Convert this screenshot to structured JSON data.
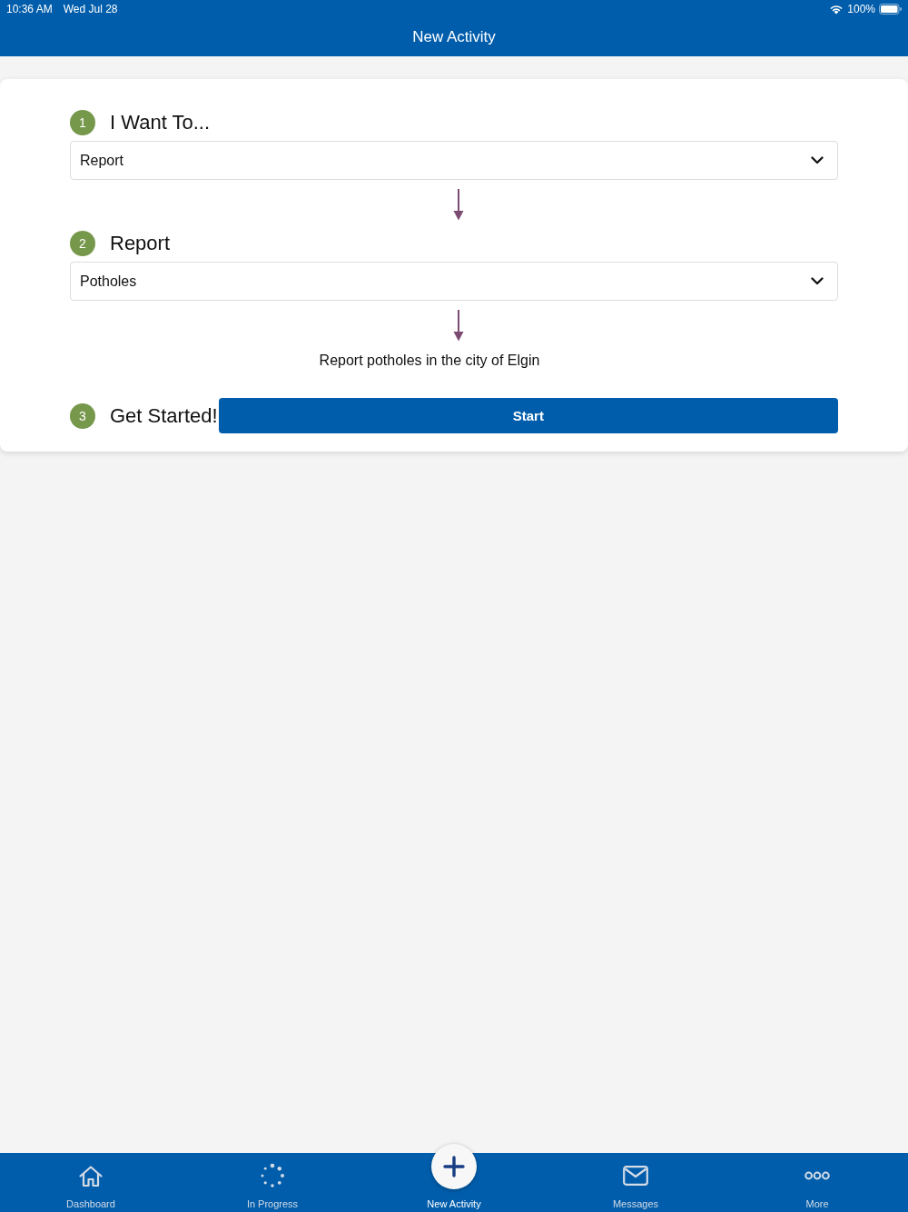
{
  "status_bar": {
    "time": "10:36 AM",
    "date": "Wed Jul 28",
    "battery": "100%"
  },
  "nav_bar": {
    "title": "New Activity"
  },
  "steps": [
    {
      "kind": "select",
      "number": "1",
      "title": "I Want To...",
      "value": "Report"
    },
    {
      "kind": "select",
      "number": "2",
      "title": "Report",
      "value": "Potholes",
      "description": "Report potholes in the city of Elgin"
    },
    {
      "kind": "action",
      "number": "3",
      "title": "Get Started!",
      "button": "Start"
    }
  ],
  "tab_bar": [
    {
      "label": "Dashboard",
      "selected": false
    },
    {
      "label": "In Progress",
      "selected": false
    },
    {
      "label": "New Activity",
      "selected": true
    },
    {
      "label": "Messages",
      "selected": false
    },
    {
      "label": "More",
      "selected": false
    }
  ]
}
